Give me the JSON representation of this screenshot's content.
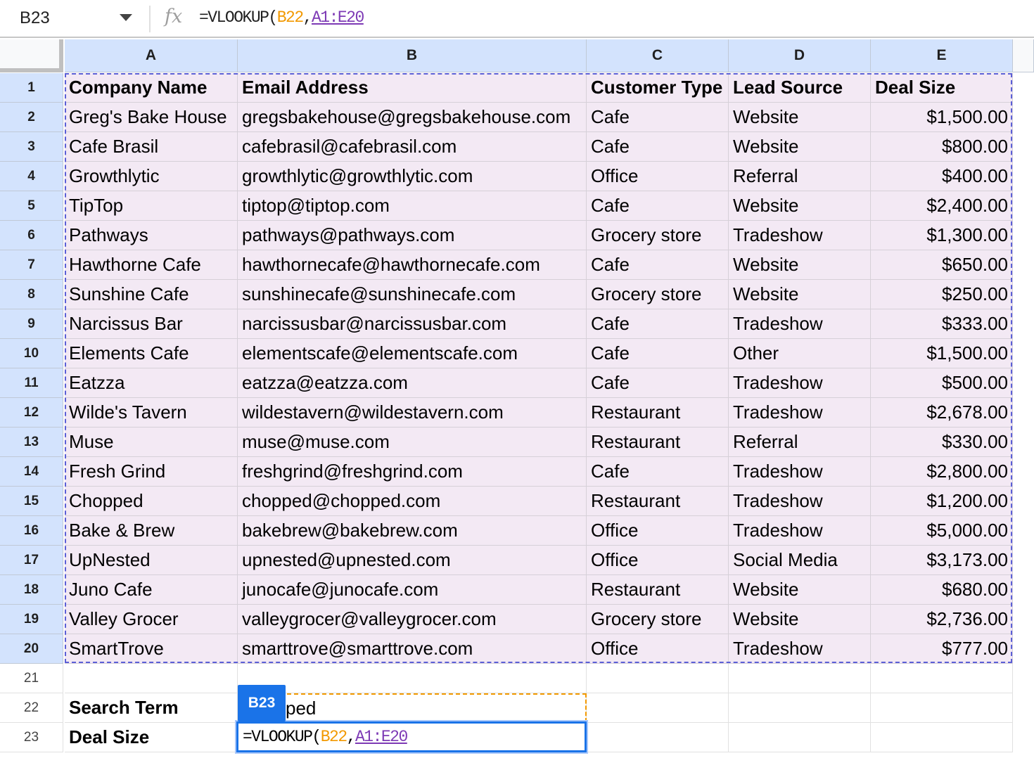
{
  "formula_bar": {
    "name_box": "B23",
    "fx": "fx",
    "formula_prefix": "=VLOOKUP(",
    "formula_arg1": "B22",
    "formula_sep": ",",
    "formula_arg2": "A1:E20"
  },
  "columns": [
    "A",
    "B",
    "C",
    "D",
    "E"
  ],
  "headers": [
    "Company Name",
    "Email Address",
    "Customer Type",
    "Lead Source",
    "Deal Size"
  ],
  "rows": [
    [
      "Greg's Bake House",
      "gregsbakehouse@gregsbakehouse.com",
      "Cafe",
      "Website",
      "$1,500.00"
    ],
    [
      "Cafe Brasil",
      "cafebrasil@cafebrasil.com",
      "Cafe",
      "Website",
      "$800.00"
    ],
    [
      "Growthlytic",
      "growthlytic@growthlytic.com",
      "Office",
      "Referral",
      "$400.00"
    ],
    [
      "TipTop",
      "tiptop@tiptop.com",
      "Cafe",
      "Website",
      "$2,400.00"
    ],
    [
      "Pathways",
      "pathways@pathways.com",
      "Grocery store",
      "Tradeshow",
      "$1,300.00"
    ],
    [
      "Hawthorne Cafe",
      "hawthornecafe@hawthornecafe.com",
      "Cafe",
      "Website",
      "$650.00"
    ],
    [
      "Sunshine Cafe",
      "sunshinecafe@sunshinecafe.com",
      "Grocery store",
      "Website",
      "$250.00"
    ],
    [
      "Narcissus Bar",
      "narcissusbar@narcissusbar.com",
      "Cafe",
      "Tradeshow",
      "$333.00"
    ],
    [
      "Elements Cafe",
      "elementscafe@elementscafe.com",
      "Cafe",
      "Other",
      "$1,500.00"
    ],
    [
      "Eatzza",
      "eatzza@eatzza.com",
      "Cafe",
      "Tradeshow",
      "$500.00"
    ],
    [
      "Wilde's Tavern",
      "wildestavern@wildestavern.com",
      "Restaurant",
      "Tradeshow",
      "$2,678.00"
    ],
    [
      "Muse",
      "muse@muse.com",
      "Restaurant",
      "Referral",
      "$330.00"
    ],
    [
      "Fresh Grind",
      "freshgrind@freshgrind.com",
      "Cafe",
      "Tradeshow",
      "$2,800.00"
    ],
    [
      "Chopped",
      "chopped@chopped.com",
      "Restaurant",
      "Tradeshow",
      "$1,200.00"
    ],
    [
      "Bake & Brew",
      "bakebrew@bakebrew.com",
      "Office",
      "Tradeshow",
      "$5,000.00"
    ],
    [
      "UpNested",
      "upnested@upnested.com",
      "Office",
      "Social Media",
      "$3,173.00"
    ],
    [
      "Juno Cafe",
      "junocafe@junocafe.com",
      "Restaurant",
      "Website",
      "$680.00"
    ],
    [
      "Valley Grocer",
      "valleygrocer@valleygrocer.com",
      "Grocery store",
      "Website",
      "$2,736.00"
    ],
    [
      "SmartTrove",
      "smarttrove@smarttrove.com",
      "Office",
      "Tradeshow",
      "$777.00"
    ]
  ],
  "row_numbers": [
    "1",
    "2",
    "3",
    "4",
    "5",
    "6",
    "7",
    "8",
    "9",
    "10",
    "11",
    "12",
    "13",
    "14",
    "15",
    "16",
    "17",
    "18",
    "19",
    "20",
    "21",
    "22",
    "23"
  ],
  "lookup": {
    "search_label": "Search Term",
    "search_value_visible": "ped",
    "deal_label": "Deal Size",
    "active_cell_tag": "B23"
  },
  "colors": {
    "selection_fill": "#f3e9f4",
    "header_selected": "#d3e3fd",
    "range_outline": "#5b5fd6",
    "ref_orange": "#f29900",
    "ref_purple": "#7d3ab5",
    "active_border": "#1a73e8"
  }
}
